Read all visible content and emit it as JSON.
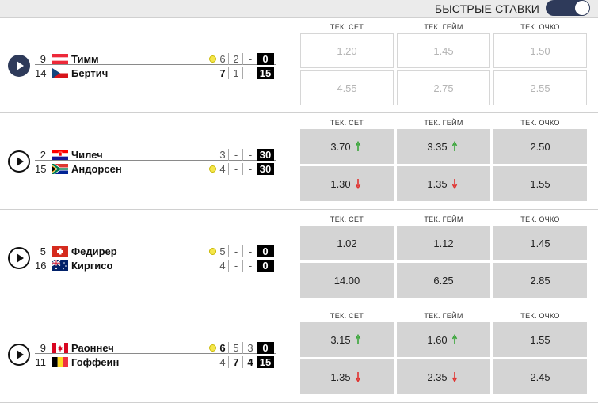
{
  "header": {
    "quick_bets_label": "БЫСТРЫЕ СТАВКИ",
    "quick_bets_enabled": true
  },
  "odds_headers": [
    "ТЕК. СЕТ",
    "ТЕК. ГЕЙМ",
    "ТЕК. ОЧКО"
  ],
  "colors": {
    "up": "#3aa63a",
    "down": "#e0322f",
    "accent": "#2e3a5a",
    "serve_ball": "#f5e64a"
  },
  "matches": [
    {
      "play_style": "filled",
      "players": [
        {
          "seed": "9",
          "country": "austria",
          "name": "Тимм",
          "serving": true,
          "scores": [
            "6",
            "2",
            "-"
          ],
          "winning": [
            false,
            false,
            false
          ],
          "points": "0"
        },
        {
          "seed": "14",
          "country": "czech",
          "name": "Бертич",
          "serving": false,
          "scores": [
            "7",
            "1",
            "-"
          ],
          "winning": [
            true,
            false,
            false
          ],
          "points": "15"
        }
      ],
      "odds_state": "disabled",
      "odds": [
        [
          "1.20",
          "1.45",
          "1.50"
        ],
        [
          "4.55",
          "2.75",
          "2.55"
        ]
      ],
      "trends": [
        [
          "",
          "",
          ""
        ],
        [
          "",
          "",
          ""
        ]
      ]
    },
    {
      "play_style": "outline",
      "players": [
        {
          "seed": "2",
          "country": "croatia",
          "name": "Чилеч",
          "serving": false,
          "scores": [
            "3",
            "-",
            "-"
          ],
          "winning": [
            false,
            false,
            false
          ],
          "points": "30"
        },
        {
          "seed": "15",
          "country": "south-africa",
          "name": "Андорсен",
          "serving": true,
          "scores": [
            "4",
            "-",
            "-"
          ],
          "winning": [
            false,
            false,
            false
          ],
          "points": "30"
        }
      ],
      "odds_state": "active",
      "odds": [
        [
          "3.70",
          "3.35",
          "2.50"
        ],
        [
          "1.30",
          "1.35",
          "1.55"
        ]
      ],
      "trends": [
        [
          "up",
          "up",
          ""
        ],
        [
          "down",
          "down",
          ""
        ]
      ]
    },
    {
      "play_style": "outline",
      "players": [
        {
          "seed": "5",
          "country": "switzerland",
          "name": "Федирер",
          "serving": true,
          "scores": [
            "5",
            "-",
            "-"
          ],
          "winning": [
            false,
            false,
            false
          ],
          "points": "0"
        },
        {
          "seed": "16",
          "country": "australia",
          "name": "Киргисо",
          "serving": false,
          "scores": [
            "4",
            "-",
            "-"
          ],
          "winning": [
            false,
            false,
            false
          ],
          "points": "0"
        }
      ],
      "odds_state": "active",
      "odds": [
        [
          "1.02",
          "1.12",
          "1.45"
        ],
        [
          "14.00",
          "6.25",
          "2.85"
        ]
      ],
      "trends": [
        [
          "",
          "",
          ""
        ],
        [
          "",
          "",
          ""
        ]
      ]
    },
    {
      "play_style": "outline",
      "players": [
        {
          "seed": "9",
          "country": "canada",
          "name": "Раоннеч",
          "serving": true,
          "scores": [
            "6",
            "5",
            "3"
          ],
          "winning": [
            true,
            false,
            false
          ],
          "points": "0"
        },
        {
          "seed": "11",
          "country": "belgium",
          "name": "Гоффеин",
          "serving": false,
          "scores": [
            "4",
            "7",
            "4"
          ],
          "winning": [
            false,
            true,
            true
          ],
          "points": "15"
        }
      ],
      "odds_state": "active",
      "odds": [
        [
          "3.15",
          "1.60",
          "1.55"
        ],
        [
          "1.35",
          "2.35",
          "2.45"
        ]
      ],
      "trends": [
        [
          "up",
          "up",
          ""
        ],
        [
          "down",
          "down",
          ""
        ]
      ]
    }
  ]
}
